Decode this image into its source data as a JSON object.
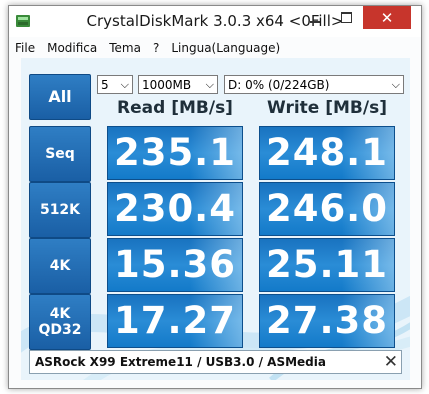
{
  "window": {
    "title": "CrystalDiskMark 3.0.3 x64 <0Fill>",
    "close_glyph": "✕",
    "icons": {
      "app": "crystaldiskmark-app-icon",
      "minimize": "minimize-icon",
      "maximize": "maximize-icon",
      "close": "close-icon"
    },
    "close_color": "#c7352c"
  },
  "menu": [
    "File",
    "Modifica",
    "Tema",
    "?",
    "Lingua(Language)"
  ],
  "controls": {
    "all_label": "All",
    "count": "5",
    "size": "1000MB",
    "drive": "D: 0% (0/224GB)",
    "dropdown_arrow": "⌵"
  },
  "headers": {
    "read": "Read [MB/s]",
    "write": "Write [MB/s]"
  },
  "rows": [
    {
      "line1": "Seq",
      "line2": "",
      "read": "235.1",
      "write": "248.1"
    },
    {
      "line1": "512K",
      "line2": "",
      "read": "230.4",
      "write": "246.0"
    },
    {
      "line1": "4K",
      "line2": "",
      "read": "15.36",
      "write": "25.11"
    },
    {
      "line1": "4K",
      "line2": "QD32",
      "read": "17.27",
      "write": "27.38"
    }
  ],
  "status": {
    "text": "ASRock X99 Extreme11 / USB3.0 / ASMedia",
    "close_glyph": "✕"
  },
  "colors": {
    "accent": "#1a6fc0",
    "label_button": "#1f66ac"
  }
}
